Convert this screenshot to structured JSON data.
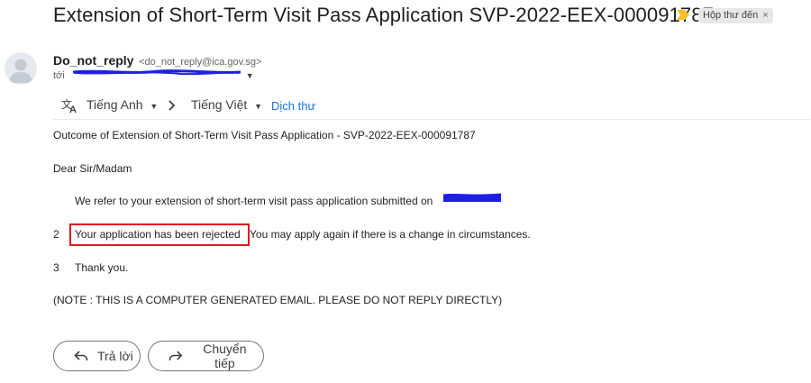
{
  "email": {
    "subject": "Extension of Short-Term Visit Pass Application SVP-2022-EEX-000091787",
    "label": "Hộp thư đến",
    "label_close": "×",
    "sender_name": "Do_not_reply",
    "sender_email": "<do_not_reply@ica.gov.sg>",
    "to_prefix": "tới",
    "translate": {
      "source_lang": "Tiếng Anh",
      "target_lang": "Tiếng Việt",
      "translate_link": "Dịch thư"
    },
    "body": {
      "heading": "Outcome of Extension of Short-Term Visit Pass Application - SVP-2022-EEX-000091787",
      "salutation": "Dear Sir/Madam",
      "para1": "We refer to your extension of short-term visit pass application submitted on",
      "para2_num": "2",
      "para2_highlight": "Your application has been rejected",
      "para2_rest": "You may apply again if there is a change in circumstances.",
      "para3_num": "3",
      "para3": "Thank you.",
      "note": "(NOTE : THIS IS A COMPUTER GENERATED EMAIL. PLEASE DO NOT REPLY DIRECTLY)"
    },
    "actions": {
      "reply": "Trả lời",
      "forward": "Chuyển tiếp"
    }
  },
  "colors": {
    "link": "#1a73e8",
    "highlight_border": "#e0161f",
    "redaction": "#1e1ee6",
    "important_marker": "#f6c026"
  }
}
